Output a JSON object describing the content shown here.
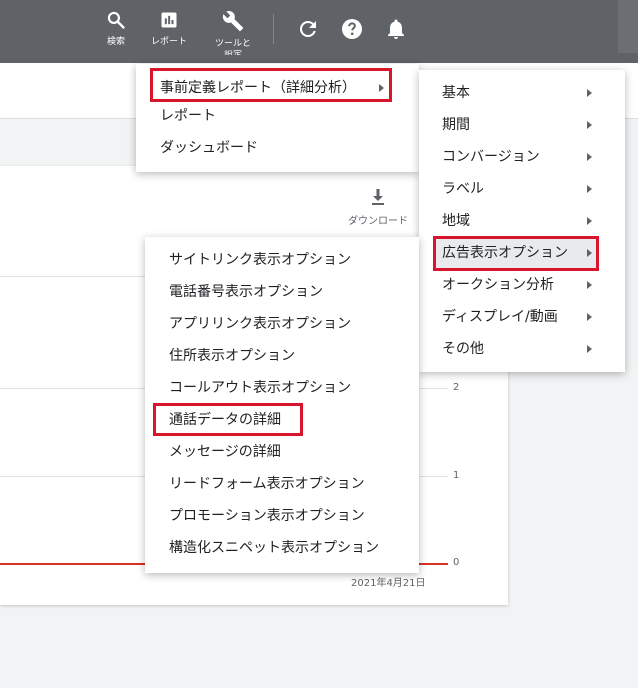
{
  "toolbar": {
    "search_label": "検索",
    "report_label": "レポート",
    "tools_label": "ツールと",
    "tools_label_2": "設定"
  },
  "download": {
    "label": "ダウンロード"
  },
  "chart": {
    "y_ticks": [
      "2",
      "1",
      "0"
    ],
    "date_label": "2021年4月21日",
    "series_color": "#d93025"
  },
  "reports_menu": {
    "items": [
      {
        "label": "事前定義レポート（詳細分析）",
        "highlighted": true,
        "has_submenu": true
      },
      {
        "label": "レポート"
      },
      {
        "label": "ダッシュボード"
      }
    ]
  },
  "predefined_menu": {
    "items": [
      {
        "label": "基本",
        "has_submenu": true
      },
      {
        "label": "期間",
        "has_submenu": true
      },
      {
        "label": "コンバージョン",
        "has_submenu": true
      },
      {
        "label": "ラベル",
        "has_submenu": true
      },
      {
        "label": "地域",
        "has_submenu": true
      },
      {
        "label": "広告表示オプション",
        "has_submenu": true,
        "highlighted": true
      },
      {
        "label": "オークション分析",
        "has_submenu": true
      },
      {
        "label": "ディスプレイ/動画",
        "has_submenu": true
      },
      {
        "label": "その他",
        "has_submenu": true
      }
    ]
  },
  "extensions_menu": {
    "items": [
      {
        "label": "サイトリンク表示オプション"
      },
      {
        "label": "電話番号表示オプション"
      },
      {
        "label": "アプリリンク表示オプション"
      },
      {
        "label": "住所表示オプション"
      },
      {
        "label": "コールアウト表示オプション"
      },
      {
        "label": "通話データの詳細",
        "highlighted": true
      },
      {
        "label": "メッセージの詳細"
      },
      {
        "label": "リードフォーム表示オプション"
      },
      {
        "label": "プロモーション表示オプション"
      },
      {
        "label": "構造化スニペット表示オプション"
      }
    ]
  },
  "colors": {
    "highlight": "#d8152b",
    "toolbar": "#5f6368"
  }
}
